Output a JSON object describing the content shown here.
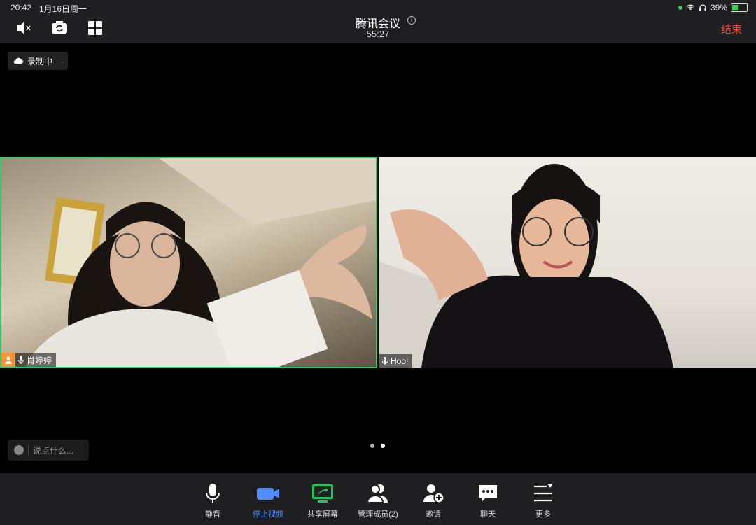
{
  "status_bar": {
    "time": "20:42",
    "date": "1月16日周一",
    "battery": "39%"
  },
  "header": {
    "title": "腾讯会议",
    "timer": "55:27",
    "end_label": "结束"
  },
  "recording": {
    "label": "录制中"
  },
  "participants": [
    {
      "name": "肖婷婷"
    },
    {
      "name": "Hoo!"
    }
  ],
  "chat": {
    "placeholder": "说点什么..."
  },
  "toolbar": {
    "mute": "静音",
    "stop_video": "停止视频",
    "share_screen": "共享屏幕",
    "manage_members": "管理成员(2)",
    "invite": "邀请",
    "chat": "聊天",
    "more": "更多"
  },
  "colors": {
    "accent": "#4d8dff",
    "end": "#e8453c",
    "active_speaker": "#2ccf68",
    "share": "#22c35e"
  }
}
